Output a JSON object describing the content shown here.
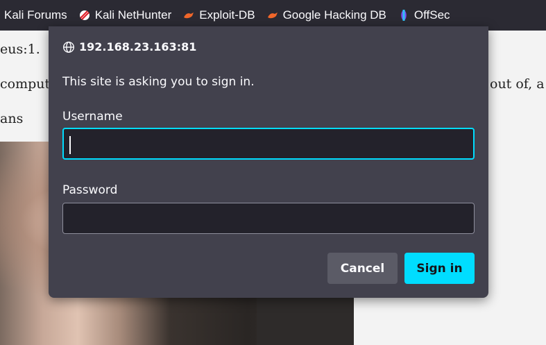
{
  "bookmarks": [
    {
      "label": "Kali Forums",
      "icon": "none"
    },
    {
      "label": "Kali NetHunter",
      "icon": "nethunter-icon"
    },
    {
      "label": "Exploit-DB",
      "icon": "exploit-db-icon"
    },
    {
      "label": "Google Hacking DB",
      "icon": "ghdb-icon"
    },
    {
      "label": "OffSec",
      "icon": "offsec-icon"
    }
  ],
  "page": {
    "line1": "eus:1.",
    "line2_left": "comput",
    "line2_right": "out of, a",
    "line3": "ans"
  },
  "dialog": {
    "origin": "192.168.23.163:81",
    "message": "This site is asking you to sign in.",
    "username_label": "Username",
    "username_value": "",
    "password_label": "Password",
    "password_value": "",
    "cancel_label": "Cancel",
    "signin_label": "Sign in"
  },
  "colors": {
    "accent": "#00ddff",
    "dialog_bg": "#42414d",
    "toolbar_bg": "#2b2a33"
  }
}
